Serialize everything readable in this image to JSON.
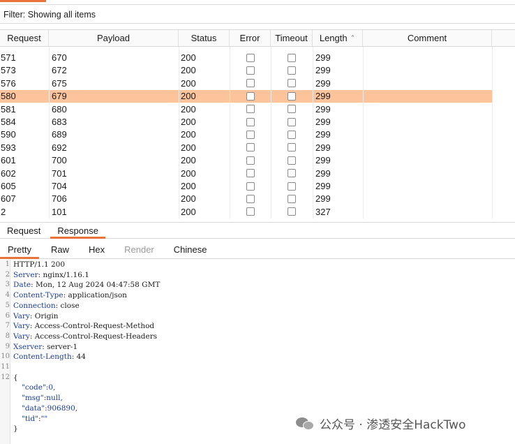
{
  "filter": {
    "text": "Filter: Showing all items"
  },
  "columns": {
    "request": "Request",
    "payload": "Payload",
    "status": "Status",
    "error": "Error",
    "timeout": "Timeout",
    "length": "Length",
    "comment": "Comment"
  },
  "rows": [
    {
      "request": "571",
      "payload": "670",
      "status": "200",
      "length": "299"
    },
    {
      "request": "573",
      "payload": "672",
      "status": "200",
      "length": "299"
    },
    {
      "request": "576",
      "payload": "675",
      "status": "200",
      "length": "299"
    },
    {
      "request": "580",
      "payload": "679",
      "status": "200",
      "length": "299"
    },
    {
      "request": "581",
      "payload": "680",
      "status": "200",
      "length": "299"
    },
    {
      "request": "584",
      "payload": "683",
      "status": "200",
      "length": "299"
    },
    {
      "request": "590",
      "payload": "689",
      "status": "200",
      "length": "299"
    },
    {
      "request": "593",
      "payload": "692",
      "status": "200",
      "length": "299"
    },
    {
      "request": "601",
      "payload": "700",
      "status": "200",
      "length": "299"
    },
    {
      "request": "602",
      "payload": "701",
      "status": "200",
      "length": "299"
    },
    {
      "request": "605",
      "payload": "704",
      "status": "200",
      "length": "299"
    },
    {
      "request": "607",
      "payload": "706",
      "status": "200",
      "length": "299"
    },
    {
      "request": "2",
      "payload": "101",
      "status": "200",
      "length": "327"
    }
  ],
  "selected_request": "580",
  "tabs_main": [
    "Request",
    "Response"
  ],
  "tabs_main_active": "Response",
  "tabs_view": [
    "Pretty",
    "Raw",
    "Hex",
    "Render",
    "Chinese"
  ],
  "tabs_view_active": "Pretty",
  "tabs_view_disabled": "Render",
  "response_lines": [
    {
      "num": "1",
      "key": "",
      "val": "HTTP/1.1 200"
    },
    {
      "num": "2",
      "key": "Server",
      "val": " nginx/1.16.1"
    },
    {
      "num": "3",
      "key": "Date",
      "val": " Mon, 12 Aug 2024 04:47:58 GMT"
    },
    {
      "num": "4",
      "key": "Content-Type",
      "val": " application/json"
    },
    {
      "num": "5",
      "key": "Connection",
      "val": " close"
    },
    {
      "num": "6",
      "key": "Vary",
      "val": " Origin"
    },
    {
      "num": "7",
      "key": "Vary",
      "val": " Access-Control-Request-Method"
    },
    {
      "num": "8",
      "key": "Vary",
      "val": " Access-Control-Request-Headers"
    },
    {
      "num": "9",
      "key": "Xserver",
      "val": " server-1"
    },
    {
      "num": "10",
      "key": "Content-Length",
      "val": " 44"
    },
    {
      "num": "11",
      "key": "",
      "val": ""
    },
    {
      "num": "12",
      "key": "",
      "val": "{"
    }
  ],
  "json_body": [
    {
      "key": "\"code\"",
      "val": "0,"
    },
    {
      "key": "\"msg\"",
      "val": "null,"
    },
    {
      "key": "\"data\"",
      "val": "906890,"
    },
    {
      "key": "\"tid\"",
      "val": "\"\""
    }
  ],
  "json_close": "}",
  "watermark": {
    "text": "公众号 · 渗透安全HackTwo"
  },
  "colors": {
    "accent": "#e8743b",
    "selected_row": "#fdc39b",
    "syntax": "#1a3a9a"
  },
  "icons": {
    "sort": "sort-ascending-icon",
    "watermark": "wechat-icon"
  }
}
